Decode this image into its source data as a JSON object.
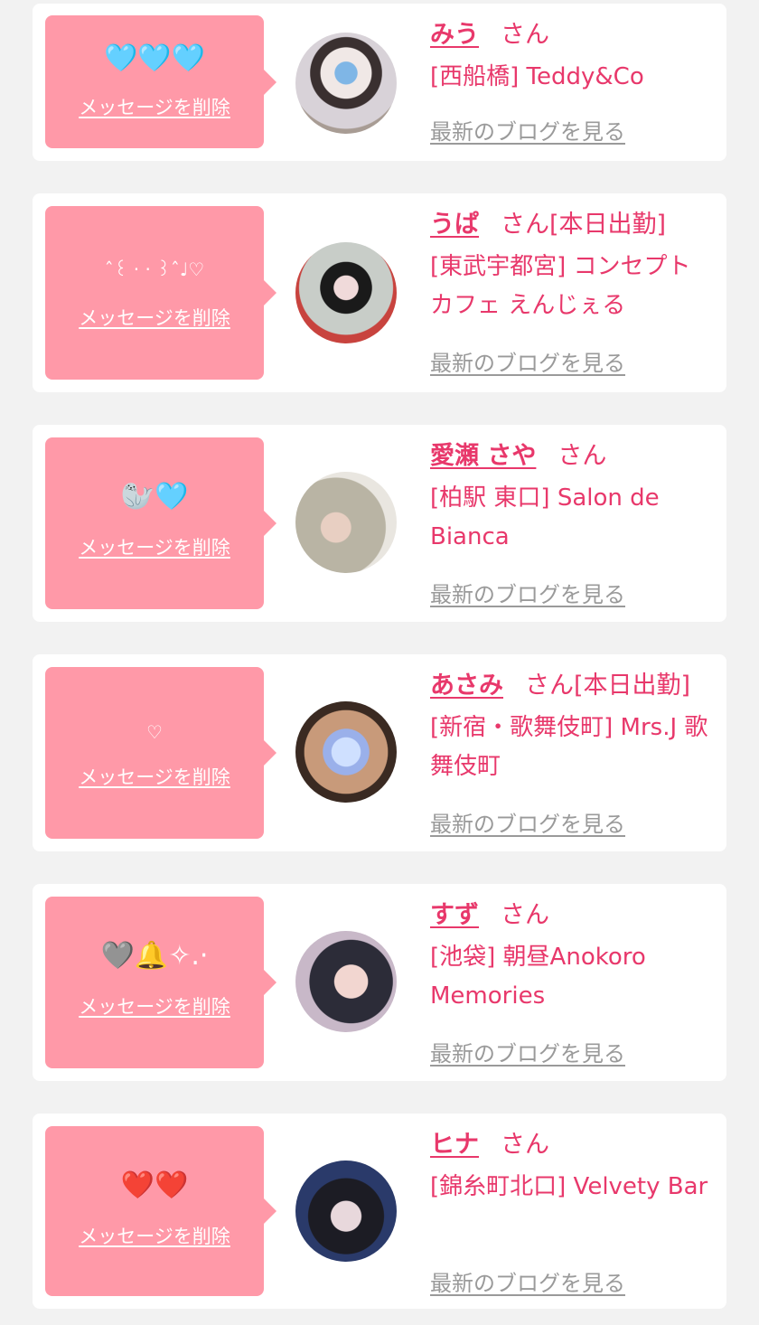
{
  "colors": {
    "accent": "#e8386b",
    "bubble": "#ff99a8",
    "link_gray": "#9a9a9a",
    "background": "#f2f2f2"
  },
  "delete_label": "メッセージを削除",
  "blog_label": "最新のブログを見る",
  "san_label": "さん",
  "cards": [
    {
      "message": "🩵🩵🩵",
      "name": "みう",
      "status": "",
      "shop": "[西船橋] Teddy&Co"
    },
    {
      "message": "ˆ꒰ ‧ ‧ ꒱ˆ♩♡",
      "name": "うぱ",
      "status": "[本日出勤]",
      "shop": "[東武宇都宮] コンセプトカフェ えんじぇる"
    },
    {
      "message": "🦭🩵",
      "name": "愛瀬 さや",
      "status": "",
      "shop": "[柏駅 東口] Salon de Bianca"
    },
    {
      "message": "♡",
      "name": "あさみ",
      "status": "[本日出勤]",
      "shop": "[新宿・歌舞伎町] Mrs.J 歌舞伎町"
    },
    {
      "message": "🩶🔔✧.·",
      "name": "すず",
      "status": "",
      "shop": "[池袋] 朝昼Anokoro Memories"
    },
    {
      "message": "❤️❤️",
      "name": "ヒナ",
      "status": "",
      "shop": "[錦糸町北口] Velvety Bar"
    }
  ]
}
